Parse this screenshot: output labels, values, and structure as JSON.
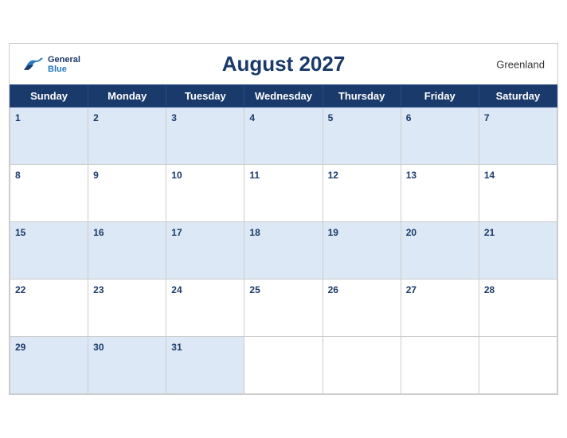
{
  "header": {
    "title": "August 2027",
    "region": "Greenland",
    "logo": {
      "general": "General",
      "blue": "Blue"
    }
  },
  "weekdays": [
    "Sunday",
    "Monday",
    "Tuesday",
    "Wednesday",
    "Thursday",
    "Friday",
    "Saturday"
  ],
  "weeks": [
    [
      1,
      2,
      3,
      4,
      5,
      6,
      7
    ],
    [
      8,
      9,
      10,
      11,
      12,
      13,
      14
    ],
    [
      15,
      16,
      17,
      18,
      19,
      20,
      21
    ],
    [
      22,
      23,
      24,
      25,
      26,
      27,
      28
    ],
    [
      29,
      30,
      31,
      null,
      null,
      null,
      null
    ]
  ]
}
